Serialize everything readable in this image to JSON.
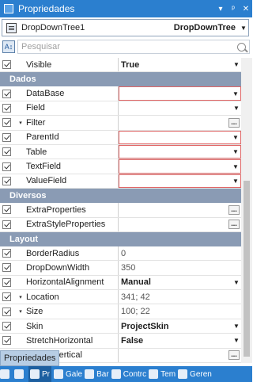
{
  "window": {
    "title": "Propriedades",
    "buttons": {
      "menu": "▾",
      "pin": "📌",
      "close": "✕"
    }
  },
  "object_selector": {
    "name": "DropDownTree1",
    "type": "DropDownTree"
  },
  "search": {
    "placeholder": "Pesquisar"
  },
  "grid": {
    "top_rows": [
      {
        "name": "Visible",
        "value": "True",
        "style": "bold",
        "editor": "dropdown"
      }
    ],
    "categories": [
      {
        "label": "Dados",
        "rows": [
          {
            "name": "DataBase",
            "value": "",
            "style": "red",
            "editor": "dropdown"
          },
          {
            "name": "Field",
            "value": "",
            "style": "plain",
            "editor": "dropdown"
          },
          {
            "name": "Filter",
            "value": "",
            "style": "plain",
            "editor": "ellipsis",
            "expander": "▾"
          },
          {
            "name": "ParentId",
            "value": "",
            "style": "red",
            "editor": "dropdown"
          },
          {
            "name": "Table",
            "value": "",
            "style": "red",
            "editor": "dropdown"
          },
          {
            "name": "TextField",
            "value": "",
            "style": "red",
            "editor": "dropdown"
          },
          {
            "name": "ValueField",
            "value": "",
            "style": "red",
            "editor": "dropdown"
          }
        ]
      },
      {
        "label": "Diversos",
        "rows": [
          {
            "name": "ExtraProperties",
            "value": "",
            "style": "plain",
            "editor": "ellipsis"
          },
          {
            "name": "ExtraStyleProperties",
            "value": "",
            "style": "plain",
            "editor": "ellipsis"
          }
        ]
      },
      {
        "label": "Layout",
        "rows": [
          {
            "name": "BorderRadius",
            "value": "0",
            "style": "gray",
            "editor": "none"
          },
          {
            "name": "DropDownWidth",
            "value": "350",
            "style": "gray",
            "editor": "none"
          },
          {
            "name": "HorizontalAlignment",
            "value": "Manual",
            "style": "bold",
            "editor": "dropdown"
          },
          {
            "name": "Location",
            "value": "341; 42",
            "style": "gray",
            "editor": "none",
            "expander": "▾"
          },
          {
            "name": "Size",
            "value": "100; 22",
            "style": "gray",
            "editor": "none",
            "expander": "▾"
          },
          {
            "name": "Skin",
            "value": "ProjectSkin",
            "style": "bold",
            "editor": "dropdown"
          },
          {
            "name": "StretchHorizontal",
            "value": "False",
            "style": "bold",
            "editor": "dropdown"
          },
          {
            "name": "StretchVertical",
            "value": "",
            "style": "plain",
            "editor": "ellipsis"
          }
        ]
      }
    ]
  },
  "bottom_tab": {
    "label": "Propriedades"
  },
  "taskbar": {
    "items": [
      {
        "label": "",
        "icon": "add-icon"
      },
      {
        "label": "",
        "icon": "tools-icon"
      },
      {
        "label": "Pr",
        "icon": "properties-icon",
        "active": true
      },
      {
        "label": "Gale",
        "icon": "gallery-icon"
      },
      {
        "label": "Bar",
        "icon": "bar-icon"
      },
      {
        "label": "Contrc",
        "icon": "controls-icon"
      },
      {
        "label": "Tem",
        "icon": "template-icon"
      },
      {
        "label": "Geren",
        "icon": "manager-icon"
      }
    ]
  }
}
